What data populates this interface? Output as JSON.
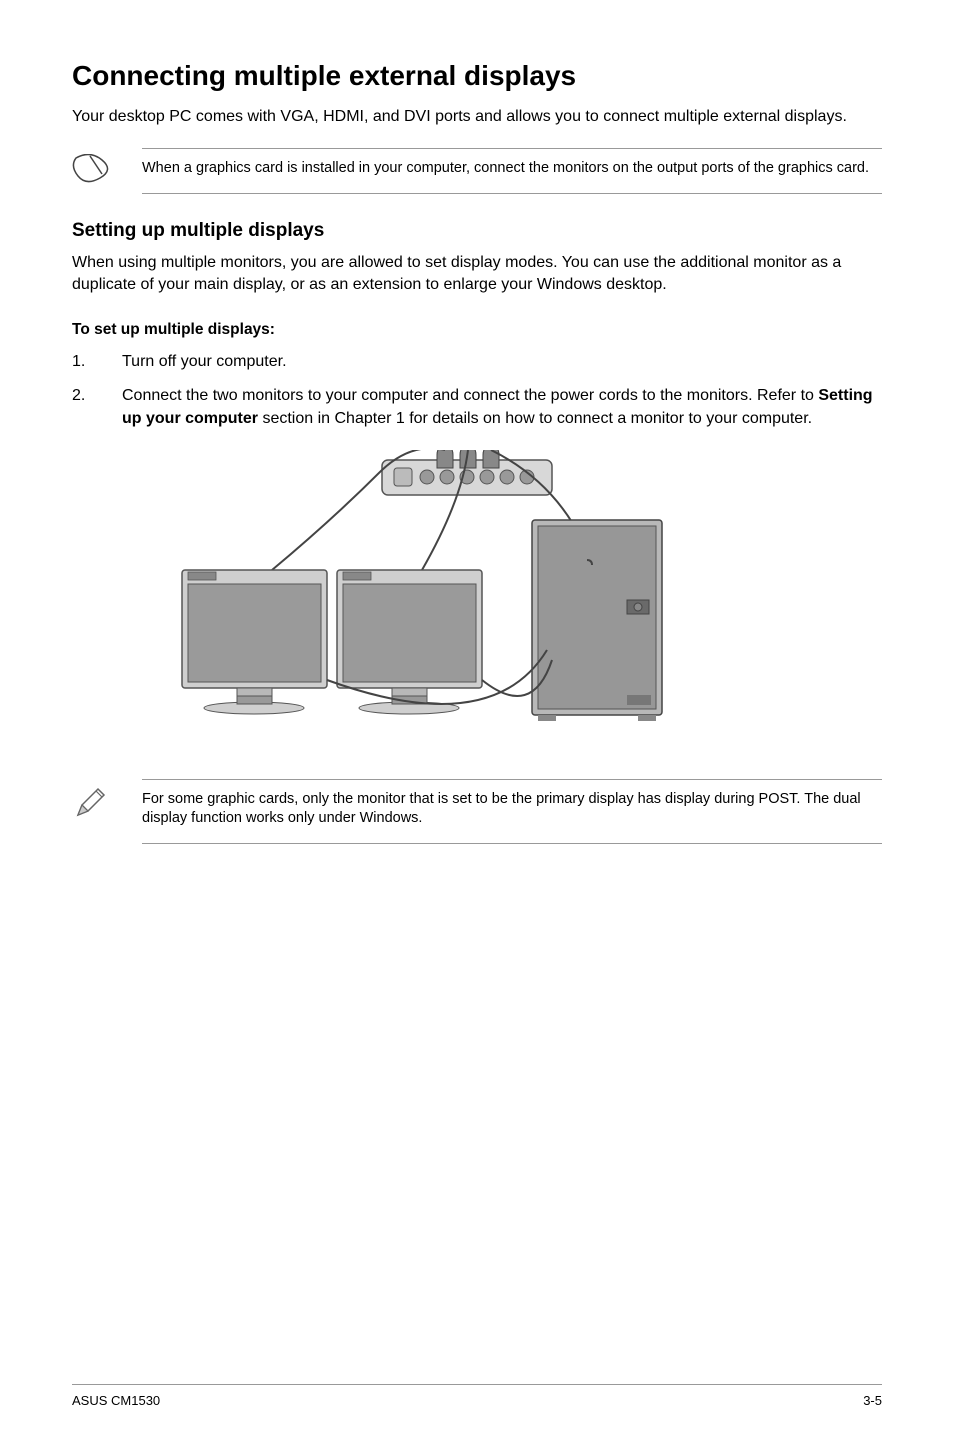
{
  "title": "Connecting multiple external displays",
  "intro": "Your desktop PC comes with VGA, HDMI, and DVI ports and allows you to connect multiple external displays.",
  "note1": "When a graphics card is installed in your computer, connect the monitors on the output ports of the graphics card.",
  "subtitle": "Setting up multiple displays",
  "section_para": "When using multiple monitors, you are allowed to set display modes. You can use the additional monitor as a duplicate of your main display, or as an extension to enlarge your Windows desktop.",
  "subhead": "To set up multiple displays:",
  "step1_num": "1.",
  "step1_text": "Turn off your computer.",
  "step2_num": "2.",
  "step2_a": "Connect the two monitors to your computer and connect the power cords to the monitors. Refer to ",
  "step2_bold": "Setting up your computer",
  "step2_b": " section in Chapter 1 for details on how to connect a monitor to your computer.",
  "note2": "For some graphic cards, only the monitor that is set to be the primary display has display during POST. The dual display function works only under Windows.",
  "footer_left": "ASUS CM1530",
  "footer_right": "3-5"
}
